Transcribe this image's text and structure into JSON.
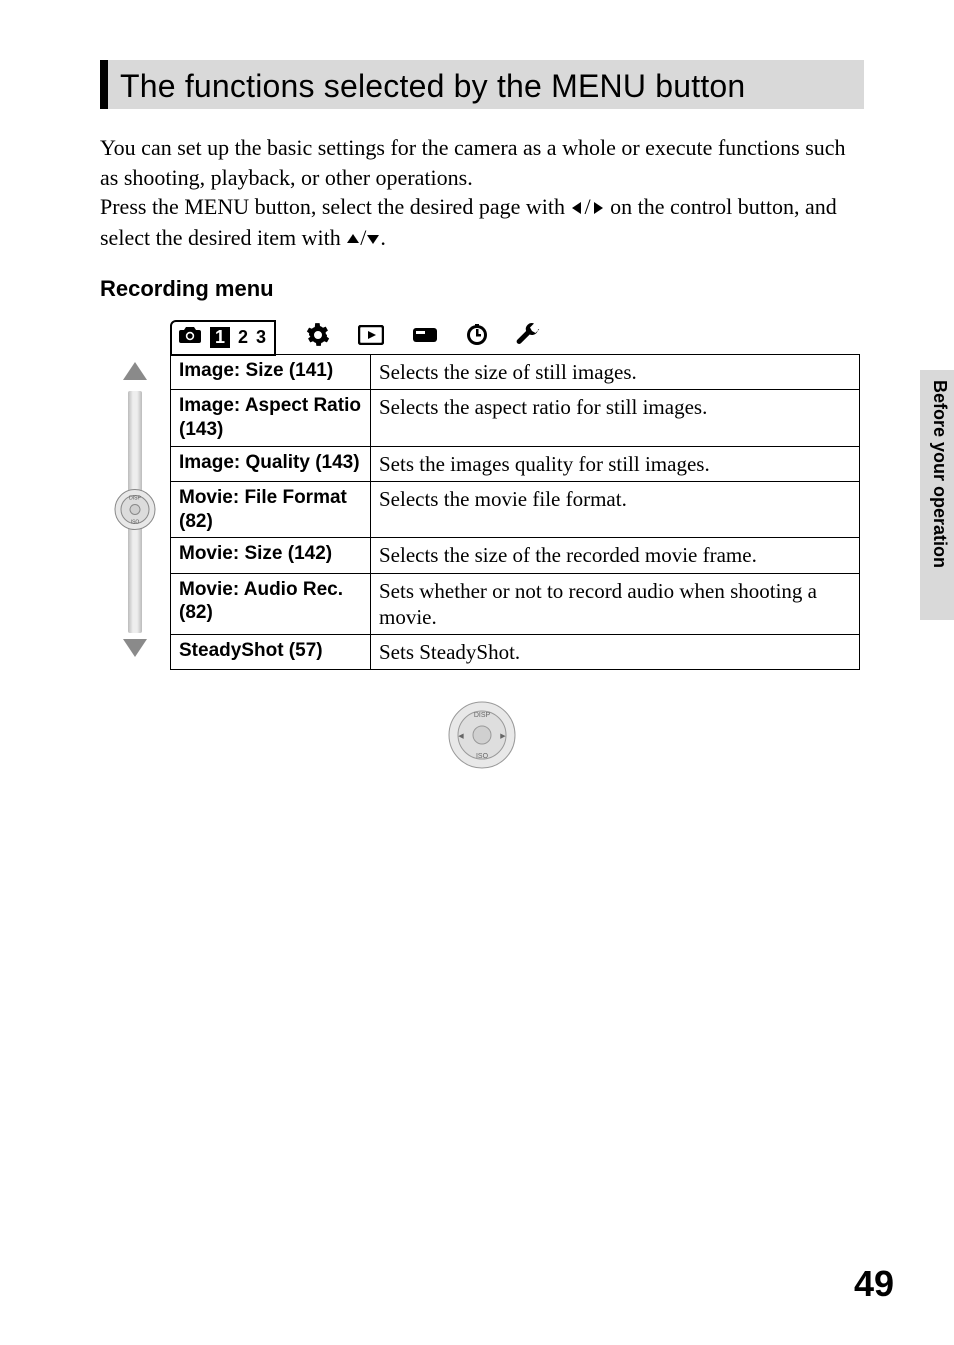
{
  "title": "The functions selected by the MENU button",
  "intro_line1": "You can set up the basic settings for the camera as a whole or execute functions such as shooting, playback, or other operations.",
  "intro_line2_a": "Press the MENU button, select the desired page with ",
  "intro_line2_b": " on the control button, and select the desired item with ",
  "intro_line2_c": ".",
  "subhead": "Recording menu",
  "tabs": {
    "n1": "1",
    "n2": "2",
    "n3": "3"
  },
  "rows": [
    {
      "name": "Image: Size (141)",
      "desc": "Selects the size of still images."
    },
    {
      "name": "Image: Aspect Ratio (143)",
      "desc": "Selects the aspect ratio for still images."
    },
    {
      "name": "Image: Quality (143)",
      "desc": "Sets the images quality for still images."
    },
    {
      "name": "Movie: File Format (82)",
      "desc": "Selects the movie file format."
    },
    {
      "name": "Movie: Size (142)",
      "desc": "Selects the size of the recorded movie frame."
    },
    {
      "name": "Movie: Audio Rec. (82)",
      "desc": "Sets whether or not to record audio when shooting a movie."
    },
    {
      "name": "SteadyShot (57)",
      "desc": "Sets SteadyShot."
    }
  ],
  "side_label": "Before your operation",
  "page_number": "49"
}
